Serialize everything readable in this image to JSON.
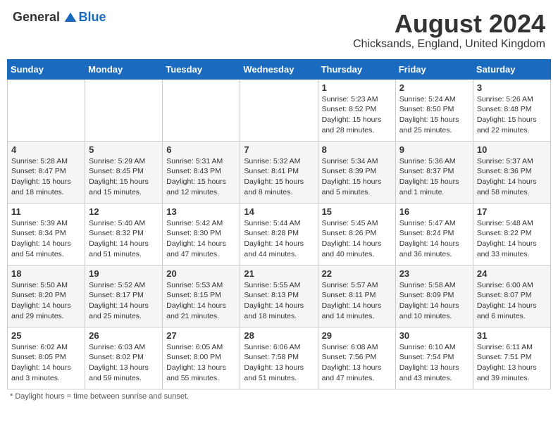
{
  "header": {
    "logo_general": "General",
    "logo_blue": "Blue",
    "month_year": "August 2024",
    "location": "Chicksands, England, United Kingdom"
  },
  "weekdays": [
    "Sunday",
    "Monday",
    "Tuesday",
    "Wednesday",
    "Thursday",
    "Friday",
    "Saturday"
  ],
  "footer": {
    "note": "Daylight hours"
  },
  "weeks": [
    [
      {
        "day": "",
        "sunrise": "",
        "sunset": "",
        "daylight": ""
      },
      {
        "day": "",
        "sunrise": "",
        "sunset": "",
        "daylight": ""
      },
      {
        "day": "",
        "sunrise": "",
        "sunset": "",
        "daylight": ""
      },
      {
        "day": "",
        "sunrise": "",
        "sunset": "",
        "daylight": ""
      },
      {
        "day": "1",
        "sunrise": "Sunrise: 5:23 AM",
        "sunset": "Sunset: 8:52 PM",
        "daylight": "Daylight: 15 hours and 28 minutes."
      },
      {
        "day": "2",
        "sunrise": "Sunrise: 5:24 AM",
        "sunset": "Sunset: 8:50 PM",
        "daylight": "Daylight: 15 hours and 25 minutes."
      },
      {
        "day": "3",
        "sunrise": "Sunrise: 5:26 AM",
        "sunset": "Sunset: 8:48 PM",
        "daylight": "Daylight: 15 hours and 22 minutes."
      }
    ],
    [
      {
        "day": "4",
        "sunrise": "Sunrise: 5:28 AM",
        "sunset": "Sunset: 8:47 PM",
        "daylight": "Daylight: 15 hours and 18 minutes."
      },
      {
        "day": "5",
        "sunrise": "Sunrise: 5:29 AM",
        "sunset": "Sunset: 8:45 PM",
        "daylight": "Daylight: 15 hours and 15 minutes."
      },
      {
        "day": "6",
        "sunrise": "Sunrise: 5:31 AM",
        "sunset": "Sunset: 8:43 PM",
        "daylight": "Daylight: 15 hours and 12 minutes."
      },
      {
        "day": "7",
        "sunrise": "Sunrise: 5:32 AM",
        "sunset": "Sunset: 8:41 PM",
        "daylight": "Daylight: 15 hours and 8 minutes."
      },
      {
        "day": "8",
        "sunrise": "Sunrise: 5:34 AM",
        "sunset": "Sunset: 8:39 PM",
        "daylight": "Daylight: 15 hours and 5 minutes."
      },
      {
        "day": "9",
        "sunrise": "Sunrise: 5:36 AM",
        "sunset": "Sunset: 8:37 PM",
        "daylight": "Daylight: 15 hours and 1 minute."
      },
      {
        "day": "10",
        "sunrise": "Sunrise: 5:37 AM",
        "sunset": "Sunset: 8:36 PM",
        "daylight": "Daylight: 14 hours and 58 minutes."
      }
    ],
    [
      {
        "day": "11",
        "sunrise": "Sunrise: 5:39 AM",
        "sunset": "Sunset: 8:34 PM",
        "daylight": "Daylight: 14 hours and 54 minutes."
      },
      {
        "day": "12",
        "sunrise": "Sunrise: 5:40 AM",
        "sunset": "Sunset: 8:32 PM",
        "daylight": "Daylight: 14 hours and 51 minutes."
      },
      {
        "day": "13",
        "sunrise": "Sunrise: 5:42 AM",
        "sunset": "Sunset: 8:30 PM",
        "daylight": "Daylight: 14 hours and 47 minutes."
      },
      {
        "day": "14",
        "sunrise": "Sunrise: 5:44 AM",
        "sunset": "Sunset: 8:28 PM",
        "daylight": "Daylight: 14 hours and 44 minutes."
      },
      {
        "day": "15",
        "sunrise": "Sunrise: 5:45 AM",
        "sunset": "Sunset: 8:26 PM",
        "daylight": "Daylight: 14 hours and 40 minutes."
      },
      {
        "day": "16",
        "sunrise": "Sunrise: 5:47 AM",
        "sunset": "Sunset: 8:24 PM",
        "daylight": "Daylight: 14 hours and 36 minutes."
      },
      {
        "day": "17",
        "sunrise": "Sunrise: 5:48 AM",
        "sunset": "Sunset: 8:22 PM",
        "daylight": "Daylight: 14 hours and 33 minutes."
      }
    ],
    [
      {
        "day": "18",
        "sunrise": "Sunrise: 5:50 AM",
        "sunset": "Sunset: 8:20 PM",
        "daylight": "Daylight: 14 hours and 29 minutes."
      },
      {
        "day": "19",
        "sunrise": "Sunrise: 5:52 AM",
        "sunset": "Sunset: 8:17 PM",
        "daylight": "Daylight: 14 hours and 25 minutes."
      },
      {
        "day": "20",
        "sunrise": "Sunrise: 5:53 AM",
        "sunset": "Sunset: 8:15 PM",
        "daylight": "Daylight: 14 hours and 21 minutes."
      },
      {
        "day": "21",
        "sunrise": "Sunrise: 5:55 AM",
        "sunset": "Sunset: 8:13 PM",
        "daylight": "Daylight: 14 hours and 18 minutes."
      },
      {
        "day": "22",
        "sunrise": "Sunrise: 5:57 AM",
        "sunset": "Sunset: 8:11 PM",
        "daylight": "Daylight: 14 hours and 14 minutes."
      },
      {
        "day": "23",
        "sunrise": "Sunrise: 5:58 AM",
        "sunset": "Sunset: 8:09 PM",
        "daylight": "Daylight: 14 hours and 10 minutes."
      },
      {
        "day": "24",
        "sunrise": "Sunrise: 6:00 AM",
        "sunset": "Sunset: 8:07 PM",
        "daylight": "Daylight: 14 hours and 6 minutes."
      }
    ],
    [
      {
        "day": "25",
        "sunrise": "Sunrise: 6:02 AM",
        "sunset": "Sunset: 8:05 PM",
        "daylight": "Daylight: 14 hours and 3 minutes."
      },
      {
        "day": "26",
        "sunrise": "Sunrise: 6:03 AM",
        "sunset": "Sunset: 8:02 PM",
        "daylight": "Daylight: 13 hours and 59 minutes."
      },
      {
        "day": "27",
        "sunrise": "Sunrise: 6:05 AM",
        "sunset": "Sunset: 8:00 PM",
        "daylight": "Daylight: 13 hours and 55 minutes."
      },
      {
        "day": "28",
        "sunrise": "Sunrise: 6:06 AM",
        "sunset": "Sunset: 7:58 PM",
        "daylight": "Daylight: 13 hours and 51 minutes."
      },
      {
        "day": "29",
        "sunrise": "Sunrise: 6:08 AM",
        "sunset": "Sunset: 7:56 PM",
        "daylight": "Daylight: 13 hours and 47 minutes."
      },
      {
        "day": "30",
        "sunrise": "Sunrise: 6:10 AM",
        "sunset": "Sunset: 7:54 PM",
        "daylight": "Daylight: 13 hours and 43 minutes."
      },
      {
        "day": "31",
        "sunrise": "Sunrise: 6:11 AM",
        "sunset": "Sunset: 7:51 PM",
        "daylight": "Daylight: 13 hours and 39 minutes."
      }
    ]
  ]
}
